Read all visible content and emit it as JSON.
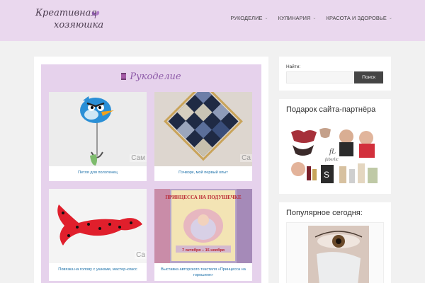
{
  "header": {
    "logo_line1": "Креативная",
    "logo_line2": "хозяюшка",
    "nav": [
      {
        "label": "РУКОДЕЛИЕ"
      },
      {
        "label": "КУЛИНАРИЯ"
      },
      {
        "label": "КРАСОТА И ЗДОРОВЬЕ"
      }
    ]
  },
  "main": {
    "section_title": "Рукоделие",
    "posts": [
      {
        "caption": "Петля для полотенец",
        "watermark": "Сам"
      },
      {
        "caption": "Пэчворк, мой первый опыт",
        "watermark": "Са"
      },
      {
        "caption": "Повязка на голову с ушками, мастер-класс",
        "watermark": "Са"
      },
      {
        "caption": "Выставка авторского текстиля «Принцесса на горошине»",
        "watermark": "",
        "poster_title": "ПРИНЦЕССА НА ПОДУШЕЧКЕ",
        "poster_dates": "7 октября – 15 ноября"
      }
    ]
  },
  "sidebar": {
    "search_label": "Найти:",
    "search_placeholder": "",
    "search_button": "Поиск",
    "partner_title": "Подарок сайта-партнёра",
    "partner_brand": "faberlic",
    "popular_title": "Популярное сегодня:"
  },
  "colors": {
    "header_bg": "#ead8ee",
    "section_bg": "#e6d2ec",
    "accent": "#8d5aa8",
    "link": "#1a6fa8",
    "button": "#454545"
  }
}
